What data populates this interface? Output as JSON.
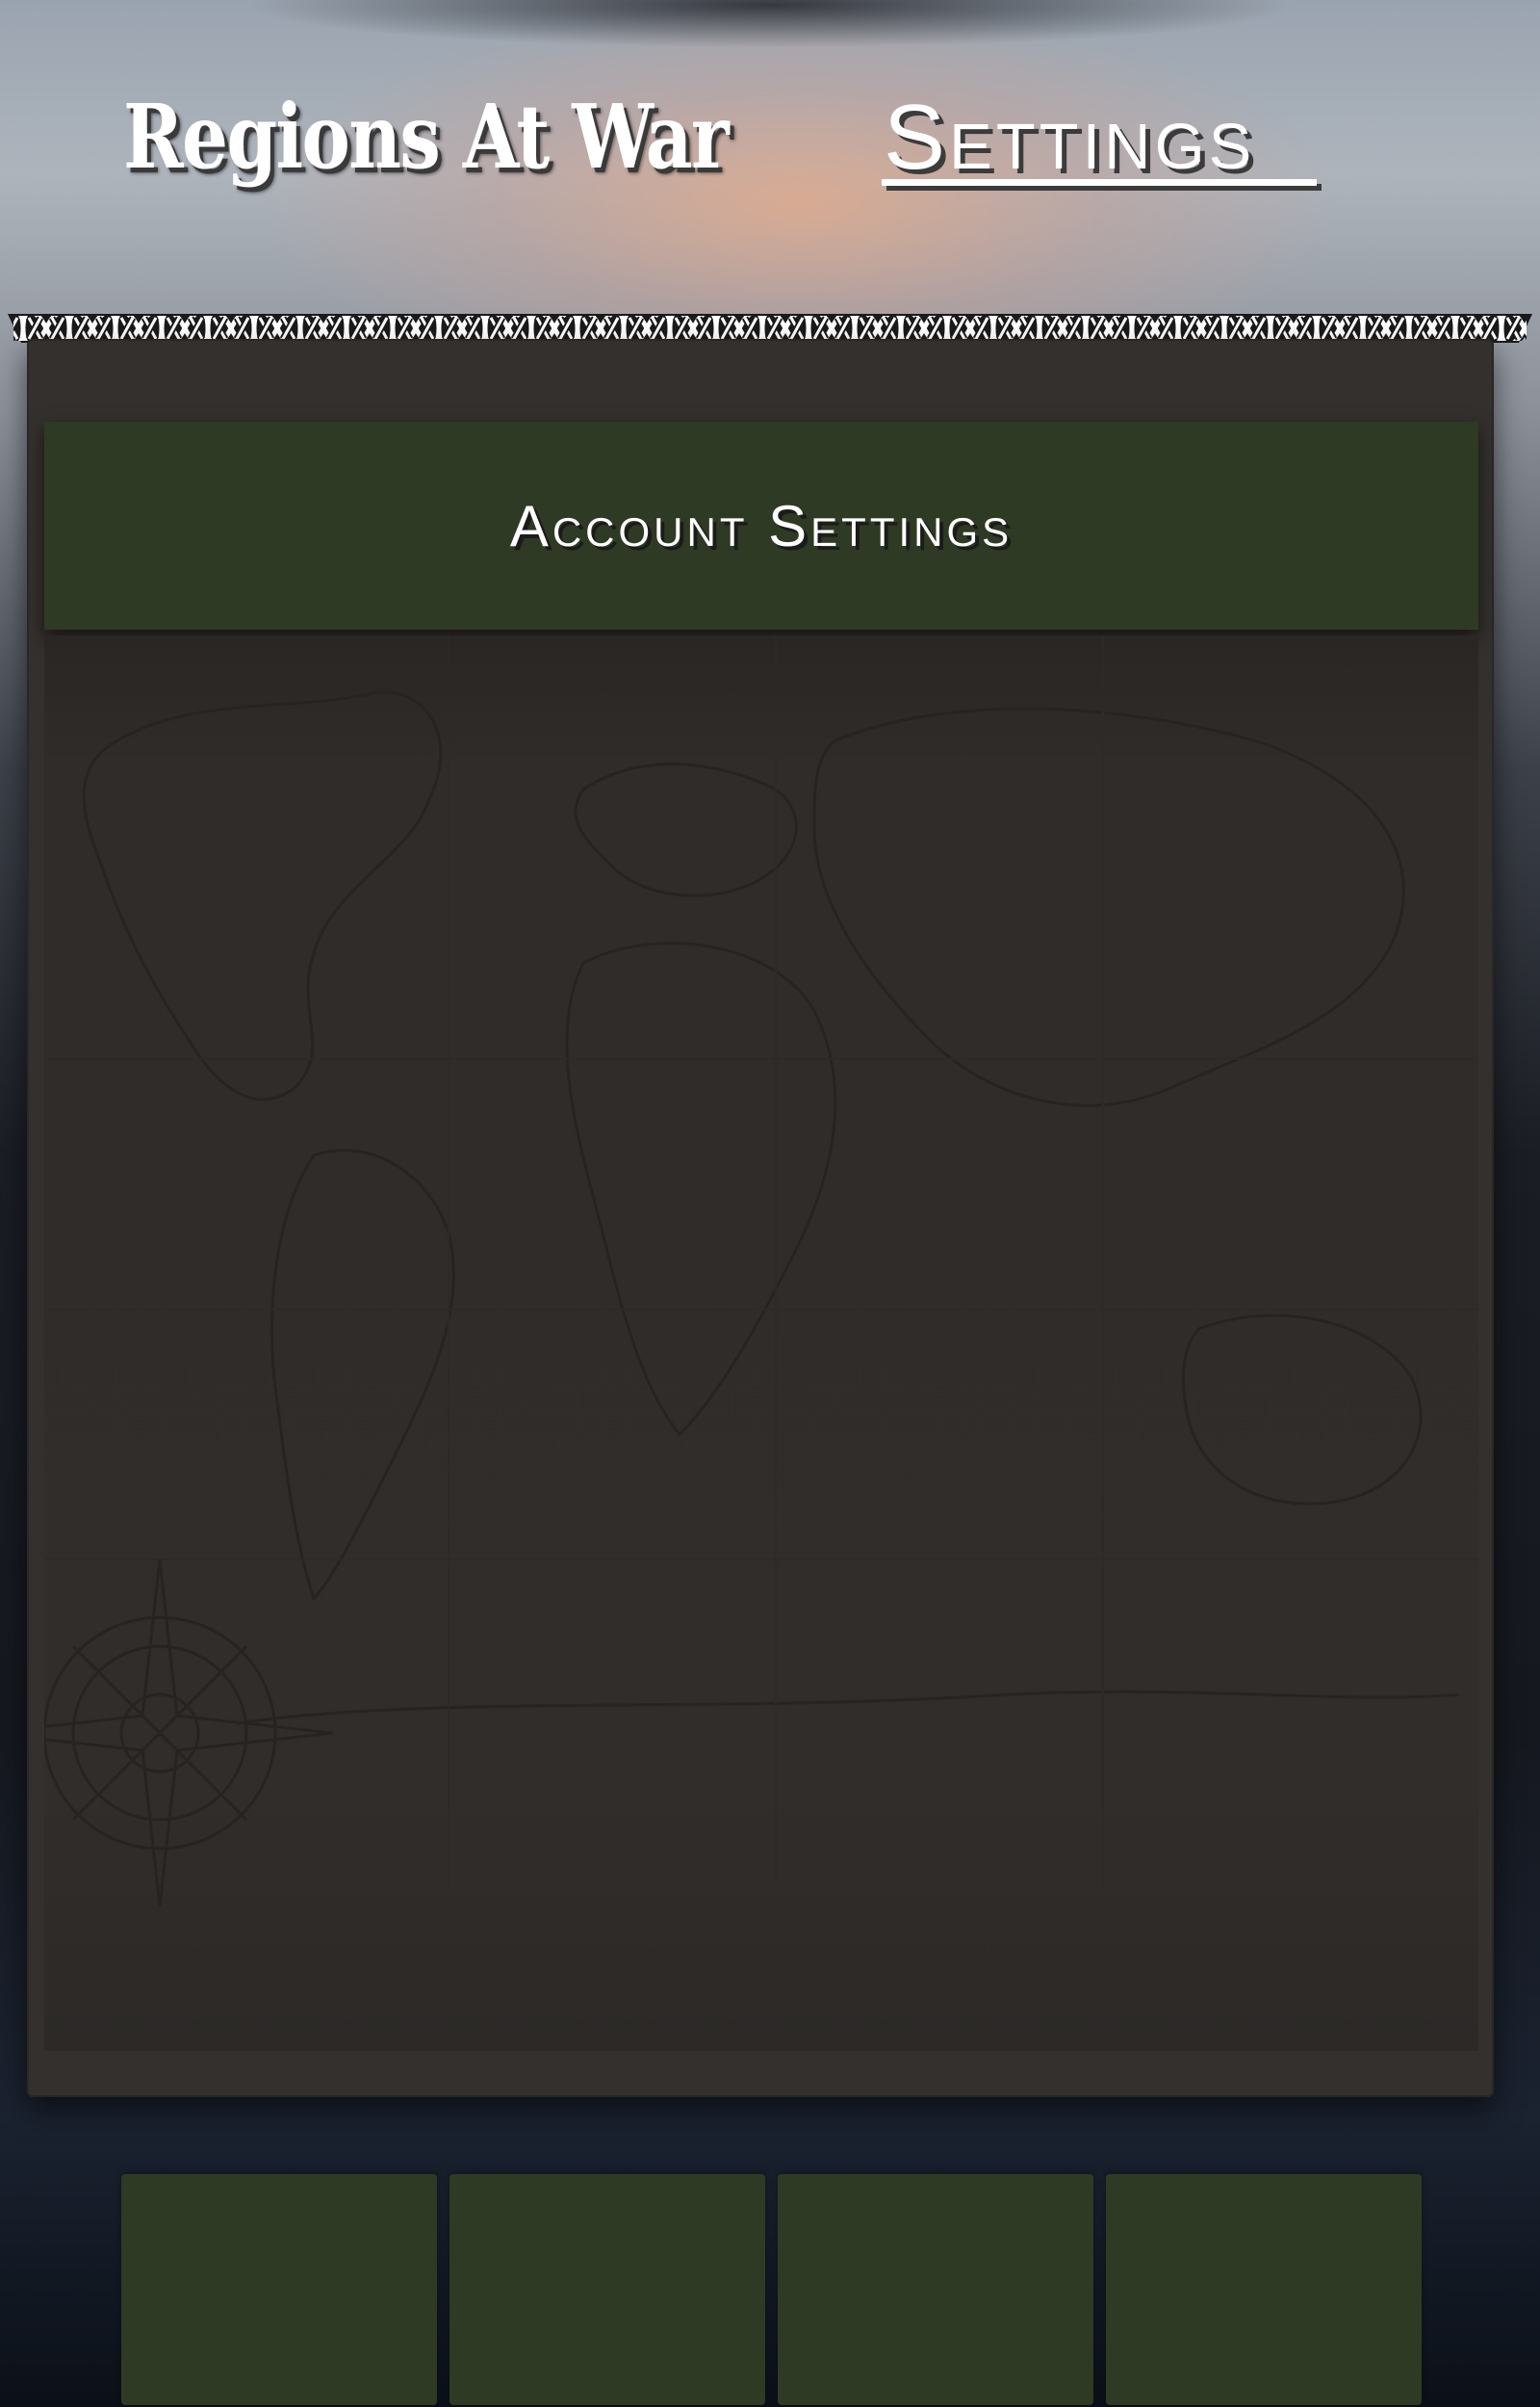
{
  "app": {
    "title": "Regions At War"
  },
  "header": {
    "nav_label": "Settings"
  },
  "panel": {
    "title": "Account Settings"
  },
  "bottom_nav": {
    "buttons": [
      "",
      "",
      "",
      ""
    ]
  },
  "colors": {
    "panel_green": "#2e3a23",
    "panel_bg": "#34302e",
    "text": "#ffffff"
  },
  "icons": {
    "divider": "celtic-knot-divider",
    "map_background": "world-map",
    "compass": "compass-rose"
  }
}
